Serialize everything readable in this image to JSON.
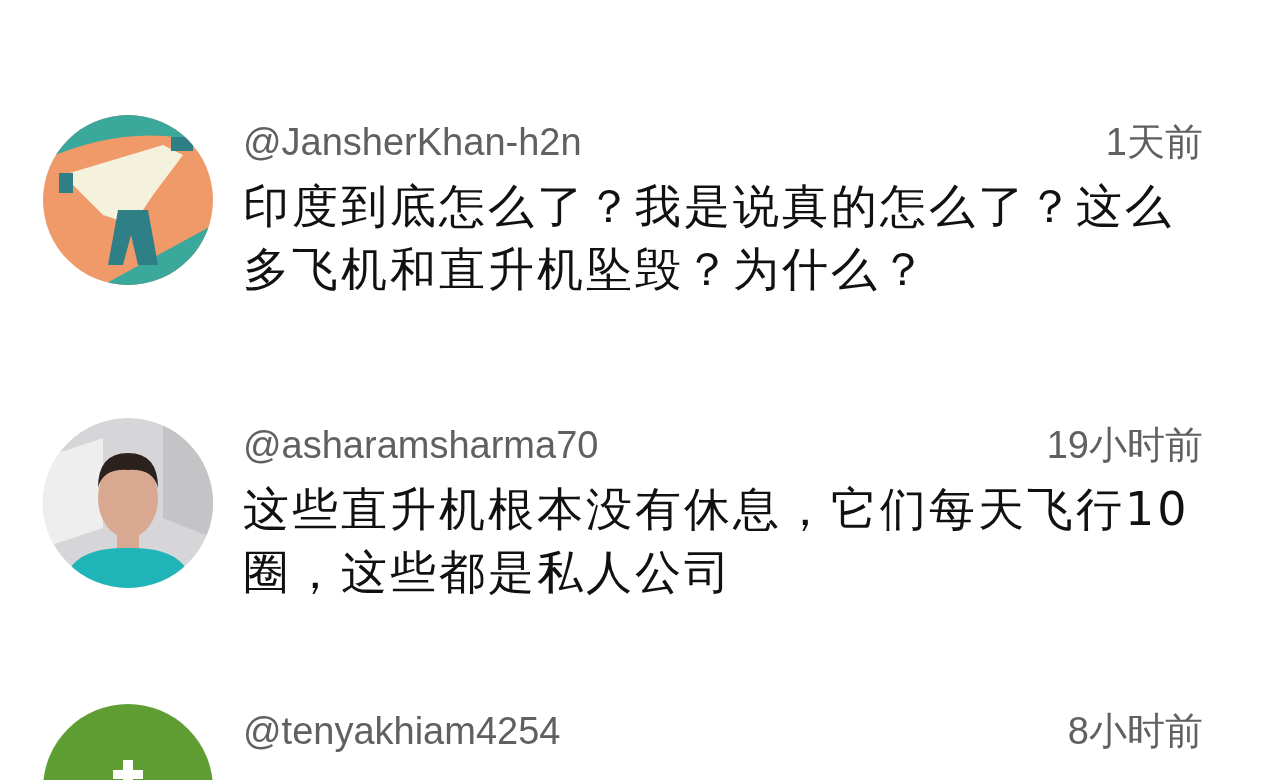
{
  "comments": [
    {
      "author": "@JansherKhan-h2n",
      "time": "1天前",
      "text": "印度到底怎么了？我是说真的怎么了？这么多飞机和直升机坠毁？为什么？",
      "avatar": {
        "kind": "art"
      }
    },
    {
      "author": "@asharamsharma70",
      "time": "19小时前",
      "text": "这些直升机根本没有休息，它们每天飞行10圈，这些都是私人公司",
      "avatar": {
        "kind": "photo"
      }
    },
    {
      "author": "@tenyakhiam4254",
      "time": "8小时前",
      "avatar": {
        "kind": "letter",
        "color": "#5e9e32"
      }
    }
  ]
}
